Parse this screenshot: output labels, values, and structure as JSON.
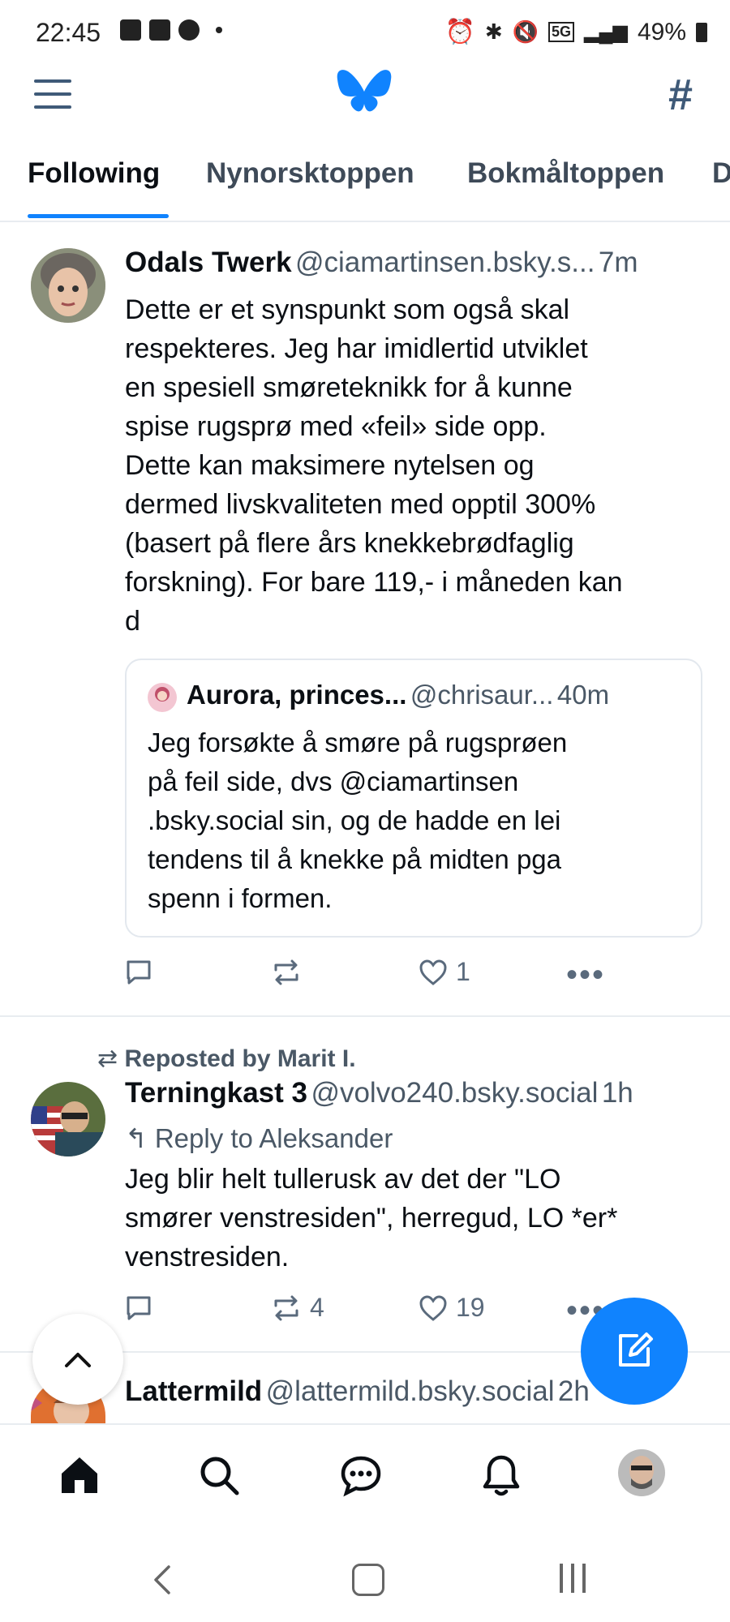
{
  "status_bar": {
    "time": "22:45",
    "battery": "49%",
    "network": "5G"
  },
  "tabs": [
    "Following",
    "Nynorsktoppen",
    "Bokmåltoppen",
    "D"
  ],
  "posts": [
    {
      "name": "Odals Twerk",
      "handle": "@ciamartinsen.bsky.s...",
      "time": "7m",
      "text_lines": [
        "Dette er et synspunkt som også skal",
        "respekteres. Jeg har imidlertid utviklet",
        "en spesiell smøreteknikk for å kunne",
        "spise rugsprø med «feil» side opp.",
        "Dette kan maksimere nytelsen og",
        "dermed livskvaliteten med opptil 300%",
        "(basert på flere års knekkebrødfaglig",
        "forskning). For bare 119,- i måneden kan",
        "d"
      ],
      "quote": {
        "name": "Aurora, princes...",
        "handle": "@chrisaur...",
        "time": "40m",
        "text_lines": [
          "Jeg forsøkte å smøre på rugsprøen",
          "på feil side, dvs @ciamartinsen",
          ".bsky.social sin, og de hadde en lei",
          "tendens til å knekke på midten pga",
          "spenn i formen."
        ]
      },
      "likes": "1",
      "reposts": "",
      "replies": ""
    },
    {
      "repost_label": "Reposted by Marit I.",
      "name": "Terningkast 3",
      "handle": "@volvo240.bsky.social",
      "time": "1h",
      "reply_label": "Reply to Aleksander",
      "text_lines": [
        "Jeg blir helt tullerusk av det der \"LO",
        "smører venstresiden\", herregud, LO *er*",
        "venstresiden."
      ],
      "reposts": "4",
      "likes": "19"
    },
    {
      "name": "Lattermild",
      "handle": "@lattermild.bsky.social",
      "time": "2h"
    }
  ],
  "colors": {
    "accent": "#1083fe",
    "muted": "#5a6a7c",
    "icon": "#3f5a78"
  },
  "bottom_nav": [
    "home-icon",
    "search-icon",
    "chat-icon",
    "bell-icon",
    "profile-avatar"
  ]
}
